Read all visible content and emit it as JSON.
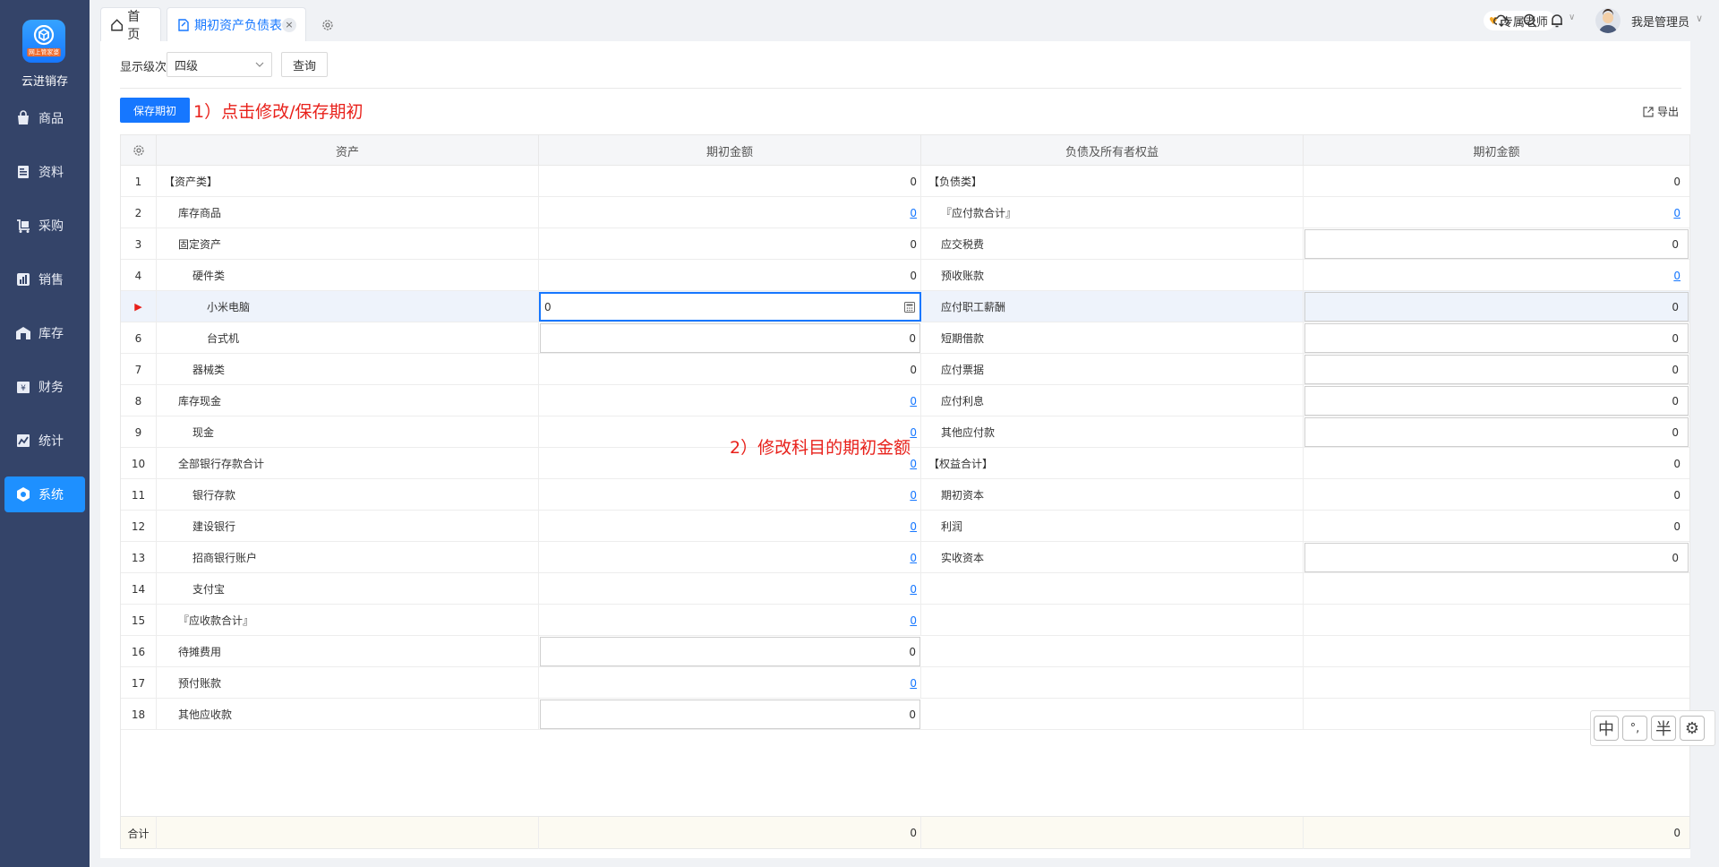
{
  "sidebar": {
    "logo_sub": "网上管家婆",
    "brand": "云进销存",
    "items": [
      {
        "label": "商品",
        "icon": "bag-icon"
      },
      {
        "label": "资料",
        "icon": "document-icon"
      },
      {
        "label": "采购",
        "icon": "cart-icon"
      },
      {
        "label": "销售",
        "icon": "chart-icon"
      },
      {
        "label": "库存",
        "icon": "warehouse-icon"
      },
      {
        "label": "财务",
        "icon": "finance-icon"
      },
      {
        "label": "统计",
        "icon": "stats-icon"
      },
      {
        "label": "系统",
        "icon": "system-icon"
      }
    ],
    "active_index": 7,
    "bg_color": "#344469",
    "active_color": "#1e90ff"
  },
  "tabs": {
    "home": "首页",
    "active": "期初资产负债表",
    "close": "×"
  },
  "header": {
    "coach": "专属老师",
    "user": "我是管理员",
    "user_arrow": "∨"
  },
  "filter": {
    "level_label": "显示级次",
    "level_value": "四级",
    "query": "查询"
  },
  "toolbar": {
    "save": "保存期初",
    "annotation1": "1）点击修改/保存期初",
    "export": "导出",
    "annotation2": "2）修改科目的期初金额"
  },
  "table": {
    "headers": [
      "资产",
      "期初金额",
      "负债及所有者权益",
      "期初金额"
    ],
    "rows": [
      {
        "no": "1",
        "asset": "【资产类】",
        "asset_val": "0",
        "liab": "【负债类】",
        "liab_val": "0"
      },
      {
        "no": "2",
        "asset": "库存商品",
        "asset_val": "0",
        "liab": "『应付款合计』",
        "liab_val": "0"
      },
      {
        "no": "3",
        "asset": "固定资产",
        "asset_val": "0",
        "liab": "应交税费",
        "liab_val": "0"
      },
      {
        "no": "4",
        "asset": "硬件类",
        "asset_val": "0",
        "liab": "预收账款",
        "liab_val": "0"
      },
      {
        "no": "▶",
        "asset": "小米电脑",
        "asset_val": "0",
        "liab": "应付职工薪酬",
        "liab_val": "0"
      },
      {
        "no": "6",
        "asset": "台式机",
        "asset_val": "0",
        "liab": "短期借款",
        "liab_val": "0"
      },
      {
        "no": "7",
        "asset": "器械类",
        "asset_val": "0",
        "liab": "应付票据",
        "liab_val": "0"
      },
      {
        "no": "8",
        "asset": "库存现金",
        "asset_val": "0",
        "liab": "应付利息",
        "liab_val": "0"
      },
      {
        "no": "9",
        "asset": "现金",
        "asset_val": "0",
        "liab": "其他应付款",
        "liab_val": "0"
      },
      {
        "no": "10",
        "asset": "全部银行存款合计",
        "asset_val": "0",
        "liab": "【权益合计】",
        "liab_val": "0"
      },
      {
        "no": "11",
        "asset": "银行存款",
        "asset_val": "0",
        "liab": "期初资本",
        "liab_val": "0"
      },
      {
        "no": "12",
        "asset": "建设银行",
        "asset_val": "0",
        "liab": "利润",
        "liab_val": "0"
      },
      {
        "no": "13",
        "asset": "招商银行账户",
        "asset_val": "0",
        "liab": "实收资本",
        "liab_val": "0"
      },
      {
        "no": "14",
        "asset": "支付宝",
        "asset_val": "0",
        "liab": "",
        "liab_val": ""
      },
      {
        "no": "15",
        "asset": "『应收款合计』",
        "asset_val": "0",
        "liab": "",
        "liab_val": ""
      },
      {
        "no": "16",
        "asset": "待摊费用",
        "asset_val": "0",
        "liab": "",
        "liab_val": ""
      },
      {
        "no": "17",
        "asset": "预付账款",
        "asset_val": "0",
        "liab": "",
        "liab_val": ""
      },
      {
        "no": "18",
        "asset": "其他应收款",
        "asset_val": "0",
        "liab": "",
        "liab_val": ""
      }
    ],
    "footer": {
      "label": "合计",
      "asset_total": "0",
      "liab_total": "0"
    }
  },
  "ime": [
    "中",
    "°,",
    "半",
    "⚙"
  ]
}
